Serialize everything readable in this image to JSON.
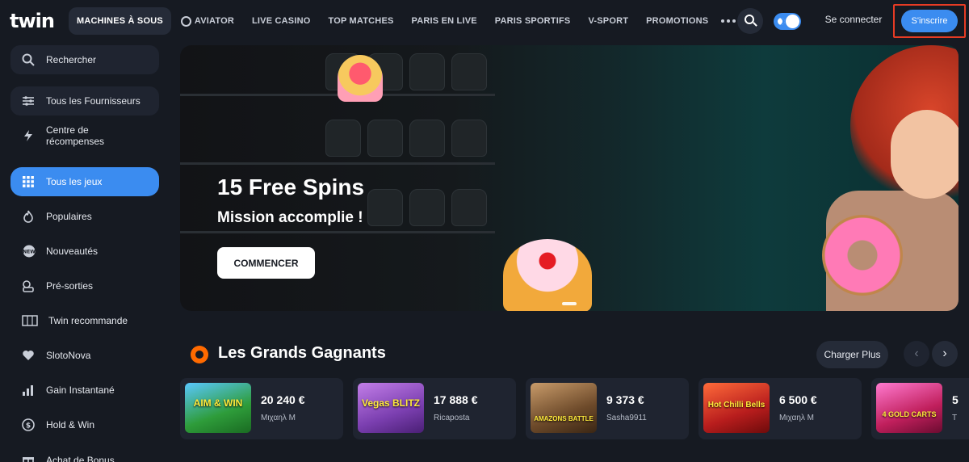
{
  "header": {
    "logo": "twin",
    "nav": [
      {
        "label": "MACHINES À SOUS",
        "active": true
      },
      {
        "label": "AVIATOR",
        "icon": "aviator-icon"
      },
      {
        "label": "LIVE CASINO"
      },
      {
        "label": "TOP MATCHES"
      },
      {
        "label": "PARIS EN LIVE"
      },
      {
        "label": "PARIS SPORTIFS"
      },
      {
        "label": "V-SPORT"
      },
      {
        "label": "PROMOTIONS"
      }
    ],
    "login": "Se connecter",
    "signup": "S'inscrire",
    "colors": {
      "accent": "#3b8cf0",
      "highlight": "#e63b24"
    }
  },
  "sidebar": {
    "items": [
      {
        "label": "Rechercher",
        "icon": "search-icon"
      },
      {
        "label": "Tous les Fournisseurs",
        "icon": "filter-icon"
      },
      {
        "label": "Centre de récompenses",
        "icon": "lightning-icon"
      },
      {
        "label": "Tous les jeux",
        "icon": "grid-icon",
        "active": true
      },
      {
        "label": "Populaires",
        "icon": "flame-icon"
      },
      {
        "label": "Nouveautés",
        "icon": "new-badge-icon"
      },
      {
        "label": "Pré-sorties",
        "icon": "presale-icon"
      },
      {
        "label": "Twin recommande",
        "icon": "slot-reels-icon"
      },
      {
        "label": "SlotoNova",
        "icon": "heart-icon"
      },
      {
        "label": "Gain Instantané",
        "icon": "bar-chart-icon"
      },
      {
        "label": "Hold & Win",
        "icon": "coin-icon"
      },
      {
        "label": "Achat de Bonus",
        "icon": "gift-icon"
      }
    ]
  },
  "banner": {
    "title": "15 Free Spins",
    "subtitle": "Mission accomplie !",
    "cta": "COMMENCER"
  },
  "winners": {
    "title": "Les Grands Gagnants",
    "load_more": "Charger Plus",
    "prev": "‹",
    "next": "›",
    "cards": [
      {
        "game": "AIM & WIN",
        "amount": "20 240 €",
        "user": "Μιχαηλ Μ",
        "thumb_color": "#2e9c3a"
      },
      {
        "game": "Vegas BLITZ",
        "amount": "17 888 €",
        "user": "Ricaposta",
        "thumb_color": "#7b3fb0"
      },
      {
        "game": "AMAZONS BATTLE",
        "amount": "9 373 €",
        "user": "Sasha9911",
        "thumb_color": "#6d4a2a"
      },
      {
        "game": "Hot Chilli Bells",
        "amount": "6 500 €",
        "user": "Μιχαηλ Μ",
        "thumb_color": "#b81d1d"
      },
      {
        "game": "4 GOLD CARTS",
        "amount": "5",
        "user": "T",
        "thumb_color": "#c01f5c"
      }
    ]
  }
}
